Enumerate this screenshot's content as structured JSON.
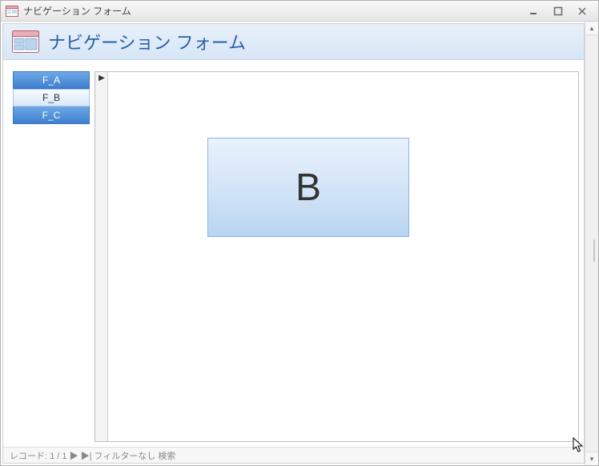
{
  "window": {
    "title": "ナビゲーション フォーム"
  },
  "form": {
    "title": "ナビゲーション フォーム"
  },
  "nav": {
    "tabs": [
      {
        "label": "F_A"
      },
      {
        "label": "F_B"
      },
      {
        "label": "F_C"
      }
    ],
    "active_index": 1
  },
  "content": {
    "display_letter": "B"
  },
  "status": {
    "text": "レコード: 1 / 1   ▶  ▶|  フィルターなし  検索"
  }
}
